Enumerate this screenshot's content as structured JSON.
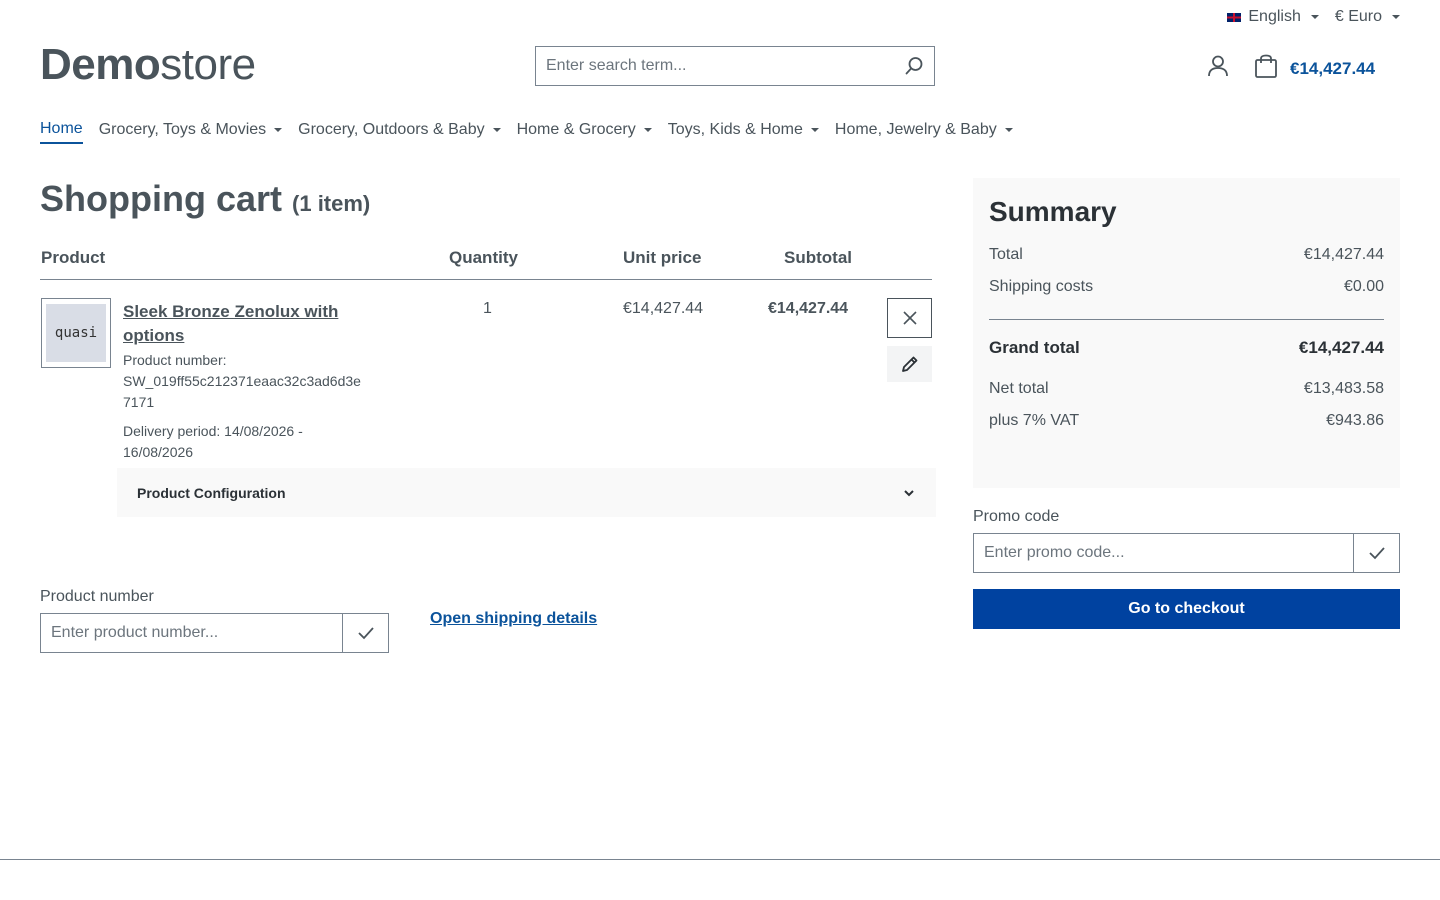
{
  "topbar": {
    "language": "English",
    "currency": "€ Euro",
    "language_icon": "uk-flag-icon"
  },
  "header": {
    "logo_bold": "Demo",
    "logo_light": "store",
    "search_placeholder": "Enter search term...",
    "cart_total": "€14,427.44"
  },
  "nav": {
    "items": [
      {
        "label": "Home",
        "active": true,
        "dropdown": false
      },
      {
        "label": "Grocery, Toys & Movies",
        "dropdown": true
      },
      {
        "label": "Grocery, Outdoors & Baby",
        "dropdown": true
      },
      {
        "label": "Home & Grocery",
        "dropdown": true
      },
      {
        "label": "Toys, Kids & Home",
        "dropdown": true
      },
      {
        "label": "Home, Jewelry & Baby",
        "dropdown": true
      }
    ]
  },
  "cart": {
    "title": "Shopping cart",
    "count": "(1 item)",
    "columns": {
      "product": "Product",
      "quantity": "Quantity",
      "unit_price": "Unit price",
      "subtotal": "Subtotal"
    },
    "item": {
      "thumb_text": "quasi",
      "name": "Sleek Bronze Zenolux with options",
      "number_label": "Product number:",
      "number": "SW_019ff55c212371eaac32c3ad6d3e7171",
      "delivery": "Delivery period: 14/08/2026 - 16/08/2026",
      "quantity": "1",
      "unit_price": "€14,427.44",
      "subtotal": "€14,427.44"
    },
    "config_label": "Product Configuration",
    "product_number_label": "Product number",
    "product_number_placeholder": "Enter product number...",
    "shipping_link": "Open shipping details"
  },
  "summary": {
    "title": "Summary",
    "total_label": "Total",
    "total": "€14,427.44",
    "shipping_label": "Shipping costs",
    "shipping": "€0.00",
    "grand_label": "Grand total",
    "grand": "€14,427.44",
    "net_label": "Net total",
    "net": "€13,483.58",
    "vat_label": "plus 7% VAT",
    "vat": "€943.86",
    "promo_label": "Promo code",
    "promo_placeholder": "Enter promo code...",
    "checkout": "Go to checkout"
  },
  "colors": {
    "accent": "#0b539b",
    "checkout_bg": "#0042a0",
    "text": "#4a545b"
  }
}
